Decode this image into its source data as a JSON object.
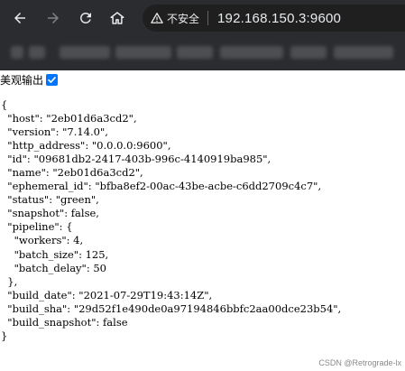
{
  "browser": {
    "security_label": "不安全",
    "url": "192.168.150.3:9600",
    "bookmarks_bar": "blurred bookmarks (unreadable)"
  },
  "page": {
    "toggle_label": "美观输出",
    "pretty_print_checked": true,
    "json_lines": [
      "{",
      "  \"host\": \"2eb01d6a3cd2\",",
      "  \"version\": \"7.14.0\",",
      "  \"http_address\": \"0.0.0.0:9600\",",
      "  \"id\": \"09681db2-2417-403b-996c-4140919ba985\",",
      "  \"name\": \"2eb01d6a3cd2\",",
      "  \"ephemeral_id\": \"bfba8ef2-00ac-43be-acbe-c6dd2709c4c7\",",
      "  \"status\": \"green\",",
      "  \"snapshot\": false,",
      "  \"pipeline\": {",
      "    \"workers\": 4,",
      "    \"batch_size\": 125,",
      "    \"batch_delay\": 50",
      "  },",
      "  \"build_date\": \"2021-07-29T19:43:14Z\",",
      "  \"build_sha\": \"29d52f1e490de0a97194846bbfc2aa00dce23b54\",",
      "  \"build_snapshot\": false",
      "}"
    ]
  },
  "watermark": "CSDN @Retrograde-lx",
  "colors": {
    "toolbar": "#2b2c2f",
    "omnibox": "#1f1f1f",
    "checkbox": "#0075ff"
  },
  "icons": [
    "back-arrow-icon",
    "forward-arrow-icon",
    "reload-icon",
    "home-icon",
    "warning-icon",
    "checkmark-icon"
  ]
}
